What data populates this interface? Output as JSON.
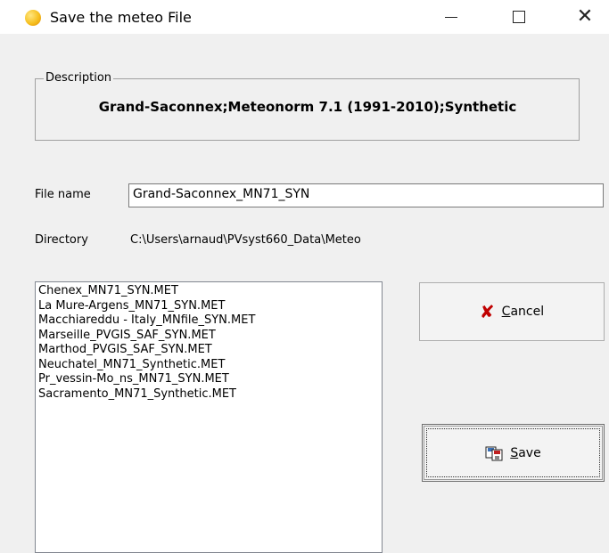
{
  "window": {
    "title": "Save the meteo File",
    "minimize_glyph": "minimize-icon",
    "maximize_glyph": "maximize-icon",
    "close_glyph": "✕"
  },
  "description": {
    "legend": "Description",
    "text": "Grand-Saconnex;Meteonorm 7.1 (1991-2010);Synthetic"
  },
  "file_name": {
    "label": "File name",
    "value": "Grand-Saconnex_MN71_SYN"
  },
  "directory": {
    "label": "Directory",
    "value": "C:\\Users\\arnaud\\PVsyst660_Data\\Meteo"
  },
  "files": [
    "Chenex_MN71_SYN.MET",
    "La Mure-Argens_MN71_SYN.MET",
    "Macchiareddu - Italy_MNfile_SYN.MET",
    "Marseille_PVGIS_SAF_SYN.MET",
    "Marthod_PVGIS_SAF_SYN.MET",
    "Neuchatel_MN71_Synthetic.MET",
    "Pr_vessin-Mo_ns_MN71_SYN.MET",
    "Sacramento_MN71_Synthetic.MET"
  ],
  "buttons": {
    "cancel_mnemonic": "C",
    "cancel_rest": "ancel",
    "save_mnemonic": "S",
    "save_rest": "ave",
    "cancel_icon": "✘"
  },
  "colors": {
    "cancel_icon": "#c00000",
    "window_bg": "#f0f0f0",
    "titlebar_bg": "#ffffff"
  }
}
